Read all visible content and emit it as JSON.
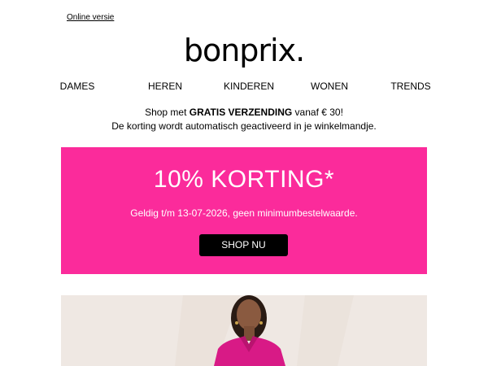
{
  "header": {
    "online_link": "Online versie",
    "logo": "bonprix."
  },
  "nav": {
    "items": [
      "DAMES",
      "HEREN",
      "KINDEREN",
      "WONEN",
      "TRENDS"
    ]
  },
  "shipping": {
    "prefix": "Shop met ",
    "bold": "GRATIS VERZENDING",
    "suffix": " vanaf € 30!",
    "line2": "De korting wordt automatisch geactiveerd in je winkelmandje."
  },
  "banner": {
    "title": "10% KORTING*",
    "subtitle": "Geldig t/m 13-07-2026, geen minimumbestelwaarde.",
    "button": "SHOP NU",
    "color": "#fb2b9b"
  },
  "colors": {
    "background": "#ffffff",
    "hero_background": "#efe9e5",
    "garment": "#d81a86"
  }
}
